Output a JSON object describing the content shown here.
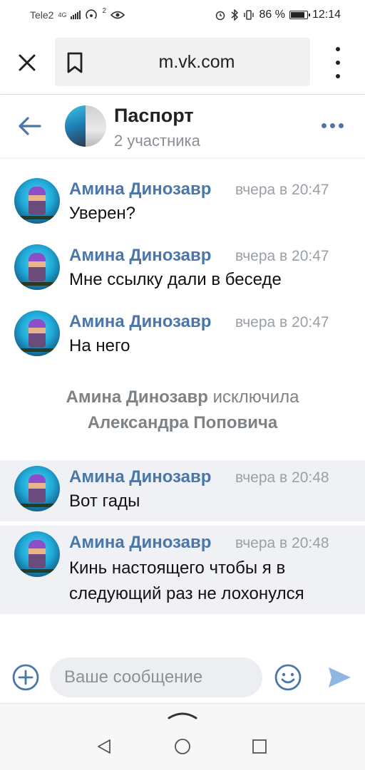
{
  "status_bar": {
    "carrier": "Tele2",
    "network": "4G",
    "notification_count": "2",
    "battery": "86 %",
    "time": "12:14"
  },
  "browser": {
    "url": "m.vk.com"
  },
  "chat": {
    "title": "Паспорт",
    "subtitle": "2 участника"
  },
  "messages": [
    {
      "sender": "Амина Динозавр",
      "time": "вчера в 20:47",
      "lines": [
        "Уверен?"
      ]
    },
    {
      "sender": "Амина Динозавр",
      "time": "вчера в 20:47",
      "lines": [
        "Мне ссылку дали в беседе"
      ]
    },
    {
      "sender": "Амина Динозавр",
      "time": "вчера в 20:47",
      "lines": [
        "На него"
      ]
    },
    {
      "sender": "Амина Динозавр",
      "time": "вчера в 20:48",
      "lines": [
        "Вот гады"
      ]
    },
    {
      "sender": "Амина Динозавр",
      "time": "вчера в 20:48",
      "lines": [
        "Кинь настоящего чтобы я в",
        "следующий раз не лохонулся"
      ]
    }
  ],
  "system_message": {
    "actor": "Амина Динозавр",
    "action": "исключила",
    "target": "Александра Поповича"
  },
  "composer": {
    "placeholder": "Ваше сообщение"
  },
  "colors": {
    "accent": "#4a76a8",
    "send": "#8fb6e0",
    "highlight_bg": "#eff1f4"
  },
  "icons": [
    "close-icon",
    "bookmark-icon",
    "more-vert-icon",
    "back-arrow-icon",
    "more-horiz-icon",
    "add-icon",
    "emoji-icon",
    "send-icon",
    "chevron-up-icon",
    "nav-back-icon",
    "nav-home-icon",
    "nav-recent-icon"
  ]
}
